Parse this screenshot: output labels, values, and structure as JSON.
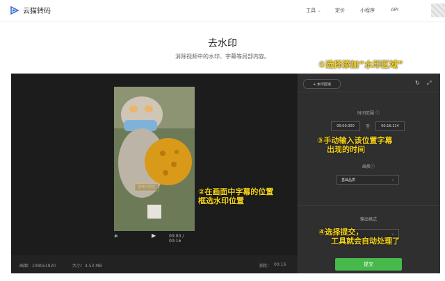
{
  "header": {
    "logo_text": "云猫转码",
    "nav": [
      "工具",
      "定价",
      "小程序",
      "API"
    ],
    "nav_tools_chevron": "⌄"
  },
  "page": {
    "title": "去水印",
    "subtitle": "消除视频中的水印、字幕等局部内容。"
  },
  "editor": {
    "add_button": "+ 水印区域",
    "time_range_label": "时间范围",
    "start_time": "00:00.000",
    "to_label": "至",
    "end_time": "00:16.114",
    "quality_label": "画质",
    "quality_value": "基础品质",
    "output_label": "输出格式",
    "submit_label": "提交"
  },
  "player": {
    "time_display": "00:00 / 00:16"
  },
  "video_caption": "猫咪开眼啦",
  "bottom_bar": {
    "resolution": "画面：1080x1920",
    "size": "大小：4.53 MB",
    "cost": "消耗：",
    "cost_value": "00:16"
  },
  "annotations": {
    "a1": "①选择添加“水印区域”",
    "a2_line1": "②在画面中字幕的位置",
    "a2_line2": "框选水印位置",
    "a3_line1": "③手动输入该位置字幕",
    "a3_line2": "出现的时间",
    "a4_line1": "④选择提交，",
    "a4_line2": "工具就会自动处理了"
  },
  "colors": {
    "accent_green": "#47b84a",
    "annotation_yellow": "#f5d31b",
    "panel_dark": "#2b2b2b"
  }
}
